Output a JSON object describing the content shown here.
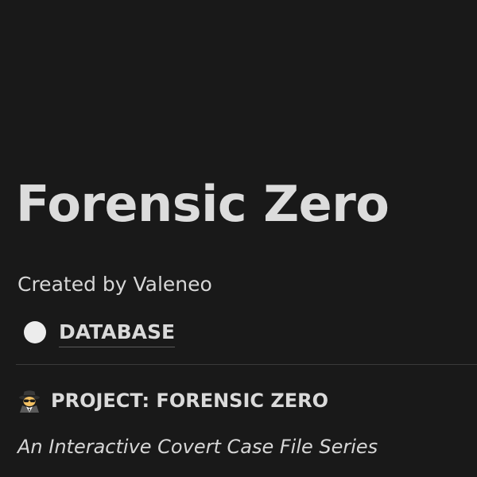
{
  "page": {
    "title": "Forensic Zero",
    "created_by": "Created by Valeneo",
    "database_link": {
      "label": "DATABASE",
      "icon": "circle-icon"
    },
    "project_heading": {
      "icon": "detective-icon",
      "text": "PROJECT: FORENSIC ZERO"
    },
    "subtitle": "An Interactive Covert Case File Series"
  },
  "colors": {
    "background": "#191919",
    "text": "#dcdcdc",
    "divider": "#3a3a3a",
    "dot": "#ececec"
  }
}
